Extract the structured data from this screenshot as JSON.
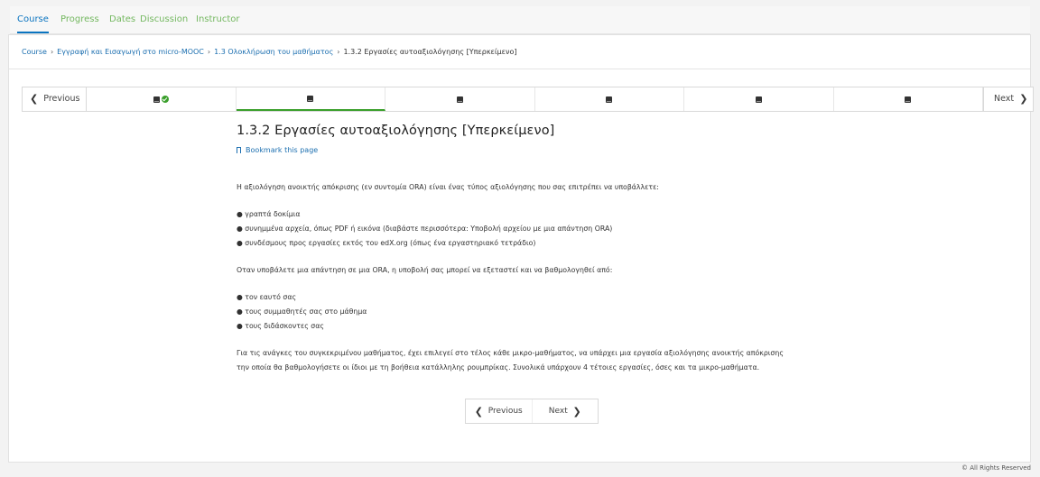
{
  "tabs": [
    {
      "label": "Course",
      "active": true
    },
    {
      "label": "Progress",
      "active": false
    },
    {
      "label": "Dates",
      "active": false
    },
    {
      "label": "Discussion",
      "active": false
    },
    {
      "label": "Instructor",
      "active": false
    }
  ],
  "breadcrumb": {
    "items": [
      "Course",
      "Εγγραφή και Εισαγωγή στο micro-MOOC",
      "1.3 Ολοκλήρωση του μαθήματος"
    ],
    "current": "1.3.2 Εργασίες αυτοαξιολόγησης [Υπερκείμενο]",
    "separator": "›"
  },
  "sequence_nav": {
    "previous_label": "Previous",
    "next_label": "Next",
    "units": [
      {
        "icon": "book-icon",
        "completed": true,
        "active": false
      },
      {
        "icon": "book-icon",
        "completed": false,
        "active": true
      },
      {
        "icon": "book-icon",
        "completed": false,
        "active": false
      },
      {
        "icon": "book-icon",
        "completed": false,
        "active": false
      },
      {
        "icon": "book-icon",
        "completed": false,
        "active": false
      },
      {
        "icon": "book-icon",
        "completed": false,
        "active": false
      }
    ]
  },
  "content": {
    "title": "1.3.2 Εργασίες αυτοαξιολόγησης [Υπερκείμενο]",
    "bookmark_label": "Bookmark this page",
    "intro": "Η αξιολόγηση ανοικτής απόκρισης (εν συντομία ORA) είναι ένας τύπος αξιολόγησης που σας επιτρέπει να υποβάλλετε:",
    "list1": [
      "● γραπτά δοκίμια",
      "● συνημμένα αρχεία, όπως PDF ή εικόνα (διαβάστε περισσότερα: Υποβολή αρχείου με μια απάντηση ORA)",
      "● συνδέσμους προς εργασίες εκτός του edX.org (όπως ένα εργαστηριακό τετράδιο)"
    ],
    "middle": "Οταν υποβάλετε μια απάντηση σε μια ORA, η υποβολή σας μπορεί να εξεταστεί και να βαθμολογηθεί από:",
    "list2": [
      "● τον εαυτό σας",
      "● τους συμμαθητές σας στο μάθημα",
      "● τους διδάσκοντες σας"
    ],
    "closing_line1": "Για τις ανάγκες του συγκεκριμένου μαθήματος, έχει επιλεγεί στο τέλος κάθε μικρο-μαθήματος, να υπάρχει μια εργασία αξιολόγησης ανοικτής απόκρισης",
    "closing_line2": "την οποία θα βαθμολογήσετε οι ίδιοι με τη βοήθεια κατάλληλης ρουμπρίκας. Συνολικά υπάρχουν 4 τέτοιες εργασίες, όσες και τα μικρο-μαθήματα."
  },
  "bottom_nav": {
    "previous_label": "Previous",
    "next_label": "Next"
  },
  "footer": {
    "text": "© All Rights Reserved"
  },
  "colors": {
    "tab_link": "#74b860",
    "tab_active": "#0a74c0",
    "link": "#1c6fb0",
    "completed": "#3a9f2b"
  }
}
